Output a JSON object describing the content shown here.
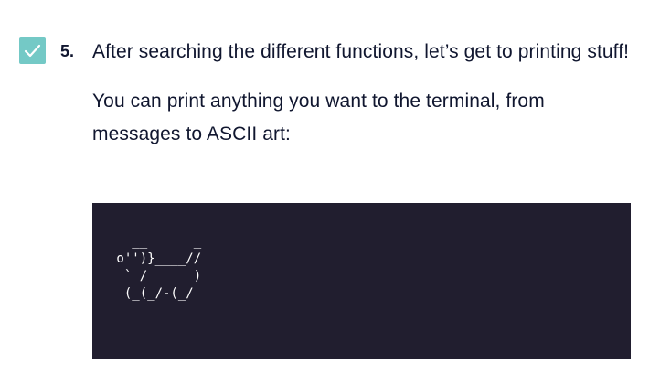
{
  "step": {
    "number": "5.",
    "checked": true,
    "accent_color": "#74c9c6",
    "paragraphs": [
      "After searching the different functions, let’s get to printing stuff!",
      "You can print anything you want to the terminal, from messages to ASCII art:"
    ]
  },
  "code_block": {
    "background": "#211e2f",
    "content": "\n   __      _\n o'')}____//\n  `_/      )\n  (_(_/-(_/"
  }
}
